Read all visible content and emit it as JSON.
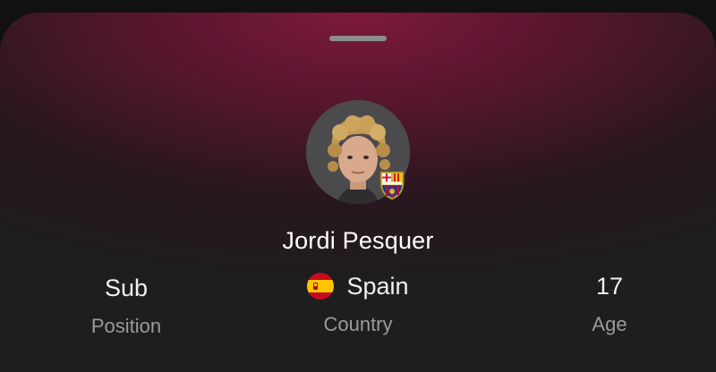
{
  "player": {
    "name": "Jordi Pesquer",
    "club_badge_icon": "fc-barcelona-crest-icon"
  },
  "stats": {
    "position": {
      "value": "Sub",
      "label": "Position"
    },
    "country": {
      "value": "Spain",
      "label": "Country",
      "flag_icon": "spain-flag-icon"
    },
    "age": {
      "value": "17",
      "label": "Age"
    }
  },
  "colors": {
    "sheet_gradient_top": "#82183e",
    "sheet_bottom": "#1f1e20",
    "text_primary": "#ffffff",
    "text_secondary": "#9b9b9f",
    "handle": "#8d8d90"
  }
}
